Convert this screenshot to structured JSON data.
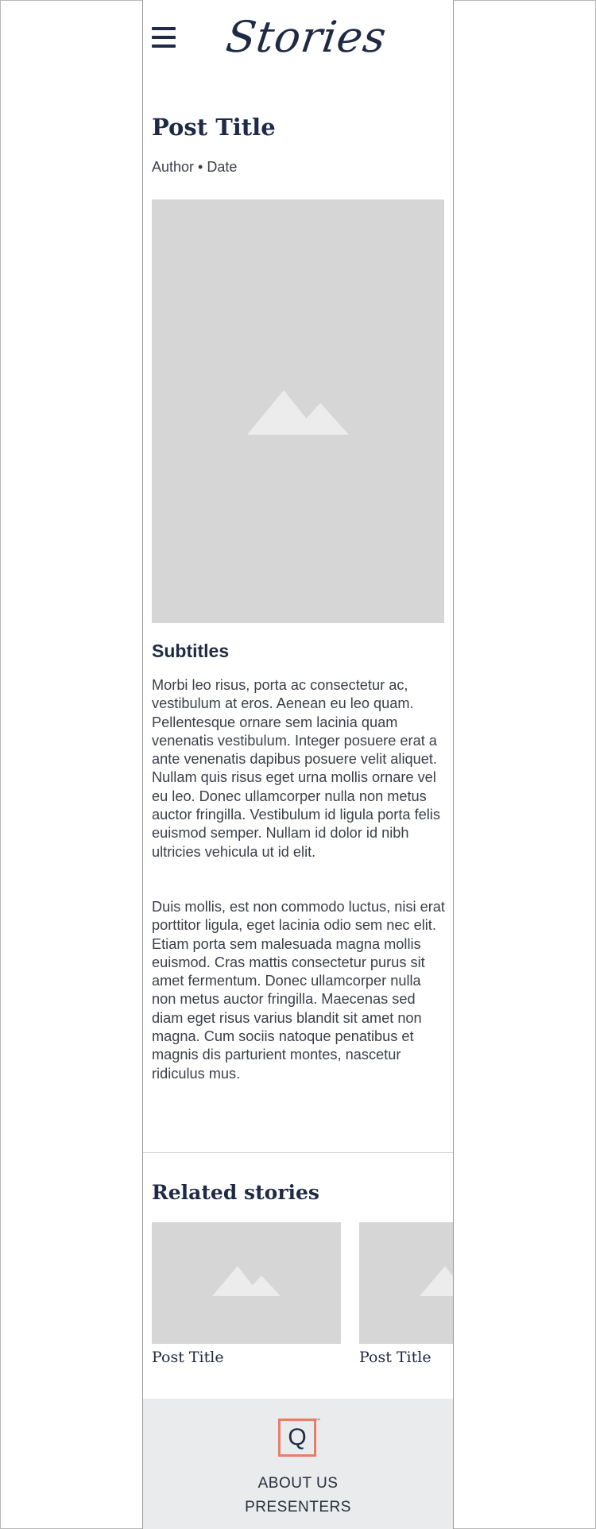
{
  "header": {
    "logo_text": "Stories",
    "menu_icon": "hamburger-menu-icon"
  },
  "post": {
    "title": "Post Title",
    "byline": "Author • Date",
    "hero_image_icon": "image-placeholder-icon",
    "subtitle": "Subtitles",
    "paragraphs": [
      "Morbi leo risus, porta ac consectetur ac, vestibulum at eros. Aenean eu leo quam. Pellentesque ornare sem lacinia quam venenatis vestibulum. Integer posuere erat a ante venenatis dapibus posuere velit aliquet. Nullam quis risus eget urna mollis ornare vel eu leo. Donec ullamcorper nulla non metus auctor fringilla. Vestibulum id ligula porta felis euismod semper. Nullam id dolor id nibh ultricies vehicula ut id elit.",
      "Duis mollis, est non commodo luctus, nisi erat porttitor ligula, eget lacinia odio sem nec elit. Etiam porta sem malesuada magna mollis euismod. Cras mattis consectetur purus sit amet fermentum. Donec ullamcorper nulla non metus auctor fringilla. Maecenas sed diam eget risus varius blandit sit amet non magna. Cum sociis natoque penatibus et magnis dis parturient montes, nascetur ridiculus mus."
    ]
  },
  "related": {
    "heading": "Related stories",
    "items": [
      {
        "title": "Post Title"
      },
      {
        "title": "Post Title"
      }
    ]
  },
  "footer": {
    "logo_glyph": "Q",
    "logo_tm": "™",
    "links": [
      "ABOUT US",
      "PRESENTERS"
    ]
  },
  "colors": {
    "navy": "#1f2a44",
    "placeholder_gray": "#d6d6d6",
    "footer_bg": "#e9ebec",
    "accent_coral": "#f07b63"
  }
}
